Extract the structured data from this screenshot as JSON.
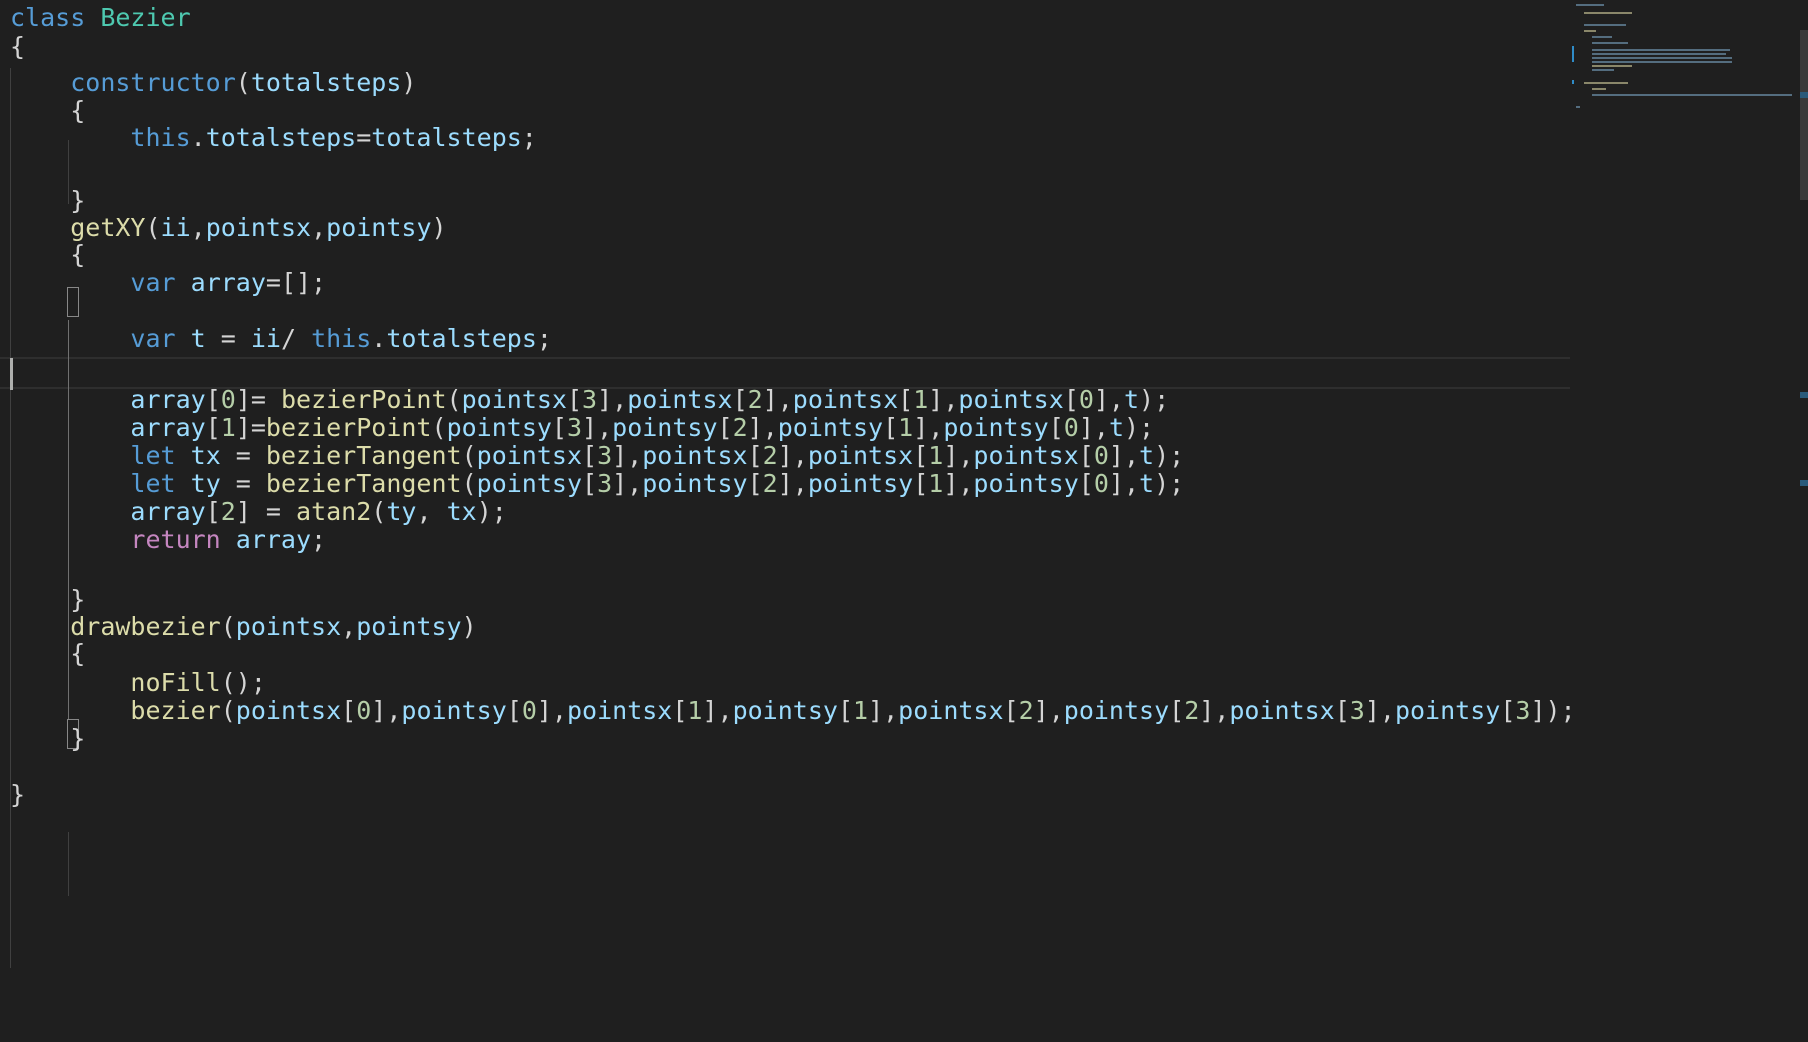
{
  "editor": {
    "language": "javascript",
    "lines": [
      [
        [
          "class ",
          "kw"
        ],
        [
          "Bezier",
          "cls"
        ]
      ],
      [
        [
          "{",
          "p"
        ]
      ],
      [
        [
          "    ",
          "p"
        ],
        [
          "constructor",
          "kw"
        ],
        [
          "(",
          "p"
        ],
        [
          "totalsteps",
          "var"
        ],
        [
          ")",
          "p"
        ]
      ],
      [
        [
          "    {",
          "p"
        ]
      ],
      [
        [
          "        ",
          "p"
        ],
        [
          "this",
          "kw"
        ],
        [
          ".",
          "p"
        ],
        [
          "totalsteps",
          "var"
        ],
        [
          "=",
          "p"
        ],
        [
          "totalsteps",
          "var"
        ],
        [
          ";",
          "p"
        ]
      ],
      [
        [
          "",
          "p"
        ]
      ],
      [
        [
          "    }",
          "p"
        ]
      ],
      [
        [
          "    ",
          "p"
        ],
        [
          "getXY",
          "fn"
        ],
        [
          "(",
          "p"
        ],
        [
          "ii",
          "var"
        ],
        [
          ",",
          "p"
        ],
        [
          "pointsx",
          "var"
        ],
        [
          ",",
          "p"
        ],
        [
          "pointsy",
          "var"
        ],
        [
          ")",
          "p"
        ]
      ],
      [
        [
          "    {",
          "p"
        ]
      ],
      [
        [
          "        ",
          "p"
        ],
        [
          "var ",
          "kw"
        ],
        [
          "array",
          "var"
        ],
        [
          "=[];",
          "p"
        ]
      ],
      [
        [
          "",
          "p"
        ]
      ],
      [
        [
          "        ",
          "p"
        ],
        [
          "var ",
          "kw"
        ],
        [
          "t",
          "var"
        ],
        [
          " = ",
          "p"
        ],
        [
          "ii",
          "var"
        ],
        [
          "/ ",
          "p"
        ],
        [
          "this",
          "kw"
        ],
        [
          ".",
          "p"
        ],
        [
          "totalsteps",
          "var"
        ],
        [
          ";",
          "p"
        ]
      ],
      [
        [
          "",
          "p"
        ]
      ],
      [
        [
          "        ",
          "p"
        ],
        [
          "array",
          "var"
        ],
        [
          "[",
          "p"
        ],
        [
          "0",
          "num"
        ],
        [
          "]= ",
          "p"
        ],
        [
          "bezierPoint",
          "fn"
        ],
        [
          "(",
          "p"
        ],
        [
          "pointsx",
          "var"
        ],
        [
          "[",
          "p"
        ],
        [
          "3",
          "num"
        ],
        [
          "],",
          "p"
        ],
        [
          "pointsx",
          "var"
        ],
        [
          "[",
          "p"
        ],
        [
          "2",
          "num"
        ],
        [
          "],",
          "p"
        ],
        [
          "pointsx",
          "var"
        ],
        [
          "[",
          "p"
        ],
        [
          "1",
          "num"
        ],
        [
          "],",
          "p"
        ],
        [
          "pointsx",
          "var"
        ],
        [
          "[",
          "p"
        ],
        [
          "0",
          "num"
        ],
        [
          "],",
          "p"
        ],
        [
          "t",
          "var"
        ],
        [
          ");",
          "p"
        ]
      ],
      [
        [
          "        ",
          "p"
        ],
        [
          "array",
          "var"
        ],
        [
          "[",
          "p"
        ],
        [
          "1",
          "num"
        ],
        [
          "]=",
          "p"
        ],
        [
          "bezierPoint",
          "fn"
        ],
        [
          "(",
          "p"
        ],
        [
          "pointsy",
          "var"
        ],
        [
          "[",
          "p"
        ],
        [
          "3",
          "num"
        ],
        [
          "],",
          "p"
        ],
        [
          "pointsy",
          "var"
        ],
        [
          "[",
          "p"
        ],
        [
          "2",
          "num"
        ],
        [
          "],",
          "p"
        ],
        [
          "pointsy",
          "var"
        ],
        [
          "[",
          "p"
        ],
        [
          "1",
          "num"
        ],
        [
          "],",
          "p"
        ],
        [
          "pointsy",
          "var"
        ],
        [
          "[",
          "p"
        ],
        [
          "0",
          "num"
        ],
        [
          "],",
          "p"
        ],
        [
          "t",
          "var"
        ],
        [
          ");",
          "p"
        ]
      ],
      [
        [
          "        ",
          "p"
        ],
        [
          "let ",
          "kw"
        ],
        [
          "tx",
          "var"
        ],
        [
          " = ",
          "p"
        ],
        [
          "bezierTangent",
          "fn"
        ],
        [
          "(",
          "p"
        ],
        [
          "pointsx",
          "var"
        ],
        [
          "[",
          "p"
        ],
        [
          "3",
          "num"
        ],
        [
          "],",
          "p"
        ],
        [
          "pointsx",
          "var"
        ],
        [
          "[",
          "p"
        ],
        [
          "2",
          "num"
        ],
        [
          "],",
          "p"
        ],
        [
          "pointsx",
          "var"
        ],
        [
          "[",
          "p"
        ],
        [
          "1",
          "num"
        ],
        [
          "],",
          "p"
        ],
        [
          "pointsx",
          "var"
        ],
        [
          "[",
          "p"
        ],
        [
          "0",
          "num"
        ],
        [
          "],",
          "p"
        ],
        [
          "t",
          "var"
        ],
        [
          ");",
          "p"
        ]
      ],
      [
        [
          "        ",
          "p"
        ],
        [
          "let ",
          "kw"
        ],
        [
          "ty",
          "var"
        ],
        [
          " = ",
          "p"
        ],
        [
          "bezierTangent",
          "fn"
        ],
        [
          "(",
          "p"
        ],
        [
          "pointsy",
          "var"
        ],
        [
          "[",
          "p"
        ],
        [
          "3",
          "num"
        ],
        [
          "],",
          "p"
        ],
        [
          "pointsy",
          "var"
        ],
        [
          "[",
          "p"
        ],
        [
          "2",
          "num"
        ],
        [
          "],",
          "p"
        ],
        [
          "pointsy",
          "var"
        ],
        [
          "[",
          "p"
        ],
        [
          "1",
          "num"
        ],
        [
          "],",
          "p"
        ],
        [
          "pointsy",
          "var"
        ],
        [
          "[",
          "p"
        ],
        [
          "0",
          "num"
        ],
        [
          "],",
          "p"
        ],
        [
          "t",
          "var"
        ],
        [
          ");",
          "p"
        ]
      ],
      [
        [
          "        ",
          "p"
        ],
        [
          "array",
          "var"
        ],
        [
          "[",
          "p"
        ],
        [
          "2",
          "num"
        ],
        [
          "] = ",
          "p"
        ],
        [
          "atan2",
          "fn"
        ],
        [
          "(",
          "p"
        ],
        [
          "ty",
          "var"
        ],
        [
          ", ",
          "p"
        ],
        [
          "tx",
          "var"
        ],
        [
          ");",
          "p"
        ]
      ],
      [
        [
          "        ",
          "p"
        ],
        [
          "return ",
          "ctl"
        ],
        [
          "array",
          "var"
        ],
        [
          ";",
          "p"
        ]
      ],
      [
        [
          "",
          "p"
        ]
      ],
      [
        [
          "    }",
          "p"
        ]
      ],
      [
        [
          "    ",
          "p"
        ],
        [
          "drawbezier",
          "fn"
        ],
        [
          "(",
          "p"
        ],
        [
          "pointsx",
          "var"
        ],
        [
          ",",
          "p"
        ],
        [
          "pointsy",
          "var"
        ],
        [
          ")",
          "p"
        ]
      ],
      [
        [
          "    {",
          "p"
        ]
      ],
      [
        [
          "        ",
          "p"
        ],
        [
          "noFill",
          "fn"
        ],
        [
          "();",
          "p"
        ]
      ],
      [
        [
          "        ",
          "p"
        ],
        [
          "bezier",
          "fn"
        ],
        [
          "(",
          "p"
        ],
        [
          "pointsx",
          "var"
        ],
        [
          "[",
          "p"
        ],
        [
          "0",
          "num"
        ],
        [
          "],",
          "p"
        ],
        [
          "pointsy",
          "var"
        ],
        [
          "[",
          "p"
        ],
        [
          "0",
          "num"
        ],
        [
          "],",
          "p"
        ],
        [
          "pointsx",
          "var"
        ],
        [
          "[",
          "p"
        ],
        [
          "1",
          "num"
        ],
        [
          "],",
          "p"
        ],
        [
          "pointsy",
          "var"
        ],
        [
          "[",
          "p"
        ],
        [
          "1",
          "num"
        ],
        [
          "],",
          "p"
        ],
        [
          "pointsx",
          "var"
        ],
        [
          "[",
          "p"
        ],
        [
          "2",
          "num"
        ],
        [
          "],",
          "p"
        ],
        [
          "pointsy",
          "var"
        ],
        [
          "[",
          "p"
        ],
        [
          "2",
          "num"
        ],
        [
          "],",
          "p"
        ],
        [
          "pointsx",
          "var"
        ],
        [
          "[",
          "p"
        ],
        [
          "3",
          "num"
        ],
        [
          "],",
          "p"
        ],
        [
          "pointsy",
          "var"
        ],
        [
          "[",
          "p"
        ],
        [
          "3",
          "num"
        ],
        [
          "]);",
          "p"
        ]
      ],
      [
        [
          "    }",
          "p"
        ]
      ],
      [
        [
          "",
          "p"
        ]
      ],
      [
        [
          "}",
          "p"
        ]
      ]
    ],
    "line_tops": [
      0,
      29,
      65,
      93,
      120,
      150,
      183,
      210,
      237,
      265,
      293,
      321,
      351,
      382,
      410,
      438,
      466,
      494,
      522,
      551,
      582,
      609,
      636,
      665,
      693,
      721,
      749,
      777
    ],
    "current_line_index": 10,
    "colors": {
      "background": "#1f1f1f",
      "keyword": "#569cd6",
      "control": "#c586c0",
      "class": "#4ec9b0",
      "function": "#dcdcaa",
      "variable": "#9cdcfe",
      "number": "#b5cea8",
      "punctuation": "#d4d4d4"
    }
  }
}
